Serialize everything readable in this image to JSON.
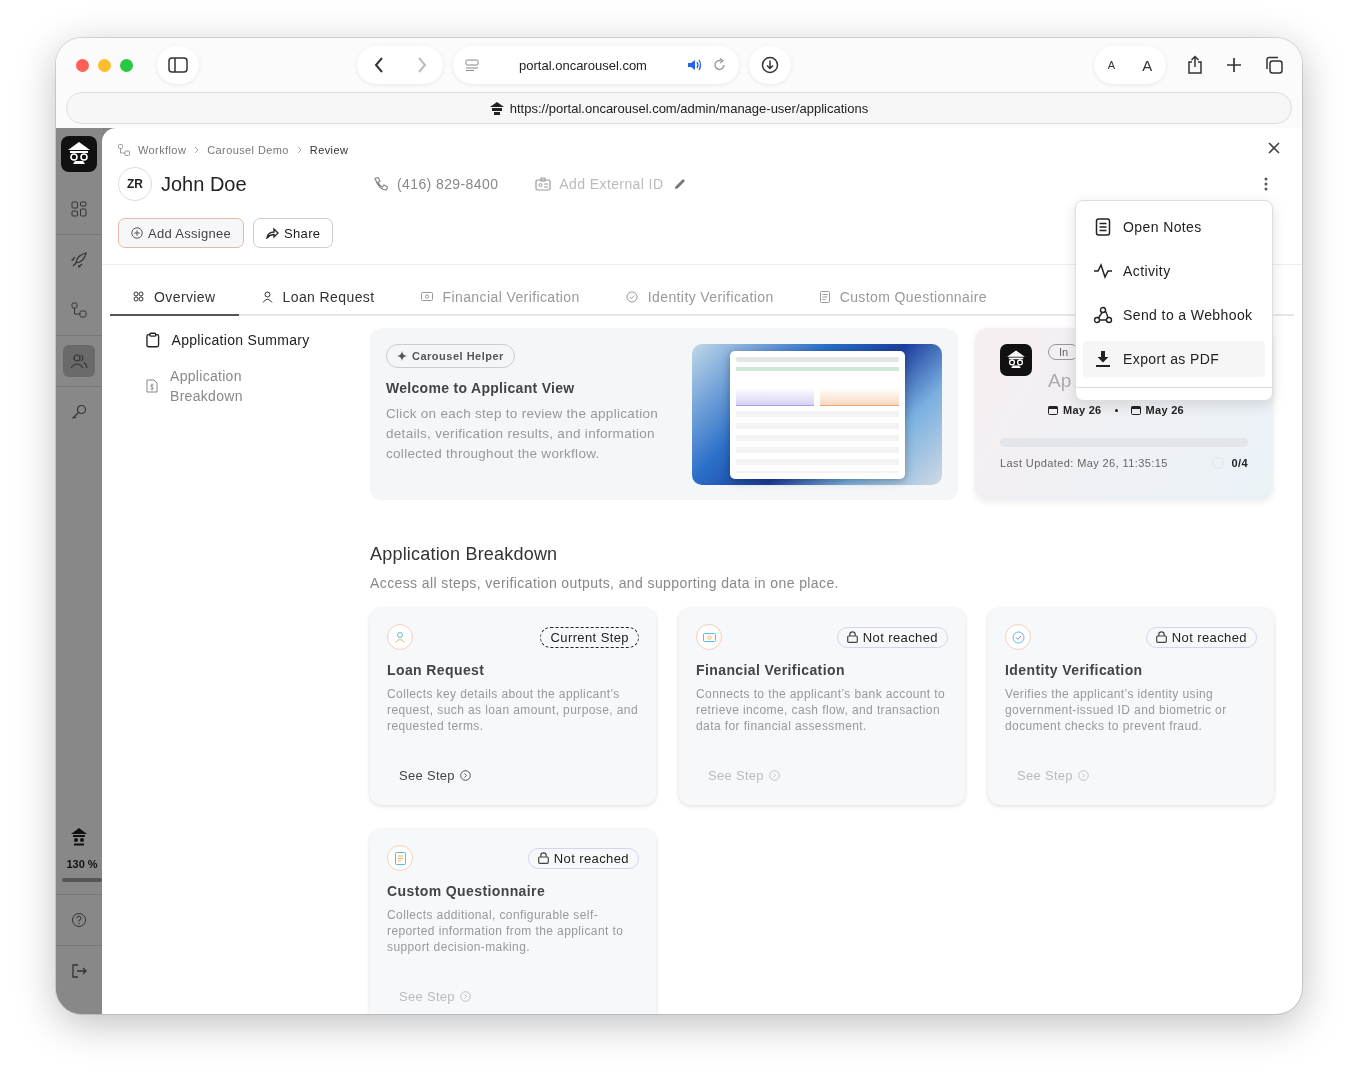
{
  "browser": {
    "site": "portal.oncarousel.com",
    "url": "https://portal.oncarousel.com/admin/manage-user/applications",
    "font_small": "A",
    "font_large": "A"
  },
  "sidebar": {
    "items": [
      {
        "selected": false
      },
      {
        "selected": false
      },
      {
        "selected": false
      },
      {
        "selected": true
      },
      {
        "selected": false
      }
    ],
    "zoom": "130 %"
  },
  "breadcrumb": [
    "Workflow",
    "Carousel Demo",
    "Review"
  ],
  "applicant": {
    "initials": "ZR",
    "name": "John Doe",
    "phone": "(416) 829-8400",
    "external_id_placeholder": "Add External ID"
  },
  "actions": [
    {
      "label": "Add Assignee",
      "kind": "assign"
    },
    {
      "label": "Share",
      "kind": "share"
    }
  ],
  "tabs": [
    {
      "label": "Overview",
      "selected": true,
      "disabled": false
    },
    {
      "label": "Loan Request",
      "selected": false,
      "disabled": false
    },
    {
      "label": "Financial Verification",
      "selected": false,
      "disabled": true
    },
    {
      "label": "Identity Verification",
      "selected": false,
      "disabled": true
    },
    {
      "label": "Custom Questionnaire",
      "selected": false,
      "disabled": true
    }
  ],
  "side_nav": [
    {
      "label": "Application Summary",
      "selected": true
    },
    {
      "label": "Application Breakdown",
      "selected": false
    }
  ],
  "welcome": {
    "badge": "Carousel Helper",
    "title": "Welcome to Applicant View",
    "text": "Click on each step to review the application details, verification results, and information collected throughout the workflow."
  },
  "status_card": {
    "badge": "In",
    "title": "Ap",
    "start_date": "May 26",
    "end_date": "May 26",
    "level": 0,
    "last_updated": "Last Updated: May 26, 11:35:15",
    "count": "0/4"
  },
  "menu": [
    {
      "label": "Open Notes",
      "highlighted": false
    },
    {
      "label": "Activity",
      "highlighted": false
    },
    {
      "label": "Send to a Webhook",
      "highlighted": false
    },
    {
      "label": "Export as PDF",
      "highlighted": true
    }
  ],
  "breakdown": {
    "title": "Application Breakdown",
    "subtitle": "Access all steps, verification outputs, and supporting data in one place.",
    "steps": [
      {
        "title": "Loan Request",
        "current": true,
        "badge": "Current Step",
        "description": "Collects key details about the applicant’s request, such as loan amount, purpose, and requested terms.",
        "link": "See Step"
      },
      {
        "title": "Financial Verification",
        "current": false,
        "badge": "Not reached",
        "description": "Connects to the applicant’s bank account to retrieve income, cash flow, and transaction data for financial assessment.",
        "link": "See Step"
      },
      {
        "title": "Identity Verification",
        "current": false,
        "badge": "Not reached",
        "description": "Verifies the applicant’s identity using government-issued ID and biometric or document checks to prevent fraud.",
        "link": "See Step"
      },
      {
        "title": "Custom Questionnaire",
        "current": false,
        "badge": "Not reached",
        "description": "Collects additional, configurable self-reported information from the applicant to support decision-making.",
        "link": "See Step"
      }
    ]
  }
}
